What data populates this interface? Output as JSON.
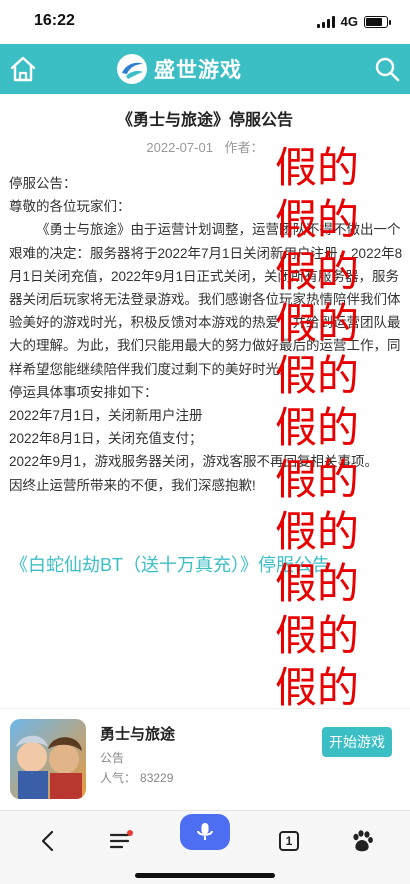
{
  "status": {
    "time": "16:22",
    "network": "4G"
  },
  "header": {
    "logo_text": "盛世游戏"
  },
  "article": {
    "title": "《勇士与旅途》停服公告",
    "date": "2022-07-01",
    "author_label": "作者：",
    "paragraphs": [
      "停服公告：",
      "尊敬的各位玩家们：",
      "《勇士与旅途》由于运营计划调整，运营团队不得不做出一个艰难的决定：服务器将于2022年7月1日关闭新用户注册，2022年8月1日关闭充值，2022年9月1日正式关闭，关闭所有服务器，服务器关闭后玩家将无法登录游戏。我们感谢各位玩家热情陪伴我们体验美好的游戏时光，积极反馈对本游戏的热爱，并给到运营团队最大的理解。为此，我们只能用最大的努力做好最后的运营工作，同样希望您能继续陪伴我们度过剩下的美好时光。",
      "停运具体事项安排如下：",
      "2022年7月1日，关闭新用户注册",
      "2022年8月1日，关闭充值支付；",
      "2022年9月1，游戏服务器关闭，游戏客服不再回复相关事项。",
      "因终止运营所带来的不便，我们深感抱歉!"
    ],
    "related_link": "《白蛇仙劫BT（送十万真充）》停服公告"
  },
  "watermark": {
    "lines": [
      "假的",
      "假的",
      "假的",
      "假的",
      "假的",
      "假的",
      "假的",
      "假的",
      "假的",
      "假的",
      "假的"
    ]
  },
  "game": {
    "name": "勇士与旅途",
    "category": "公告",
    "popularity_label": "人气：",
    "popularity": "83229",
    "play_label": "开始游戏"
  },
  "toolbar": {
    "tabs_count": "1"
  },
  "colors": {
    "accent": "#3bbfc5",
    "watermark": "#e60000",
    "mic": "#4e6ef2"
  }
}
